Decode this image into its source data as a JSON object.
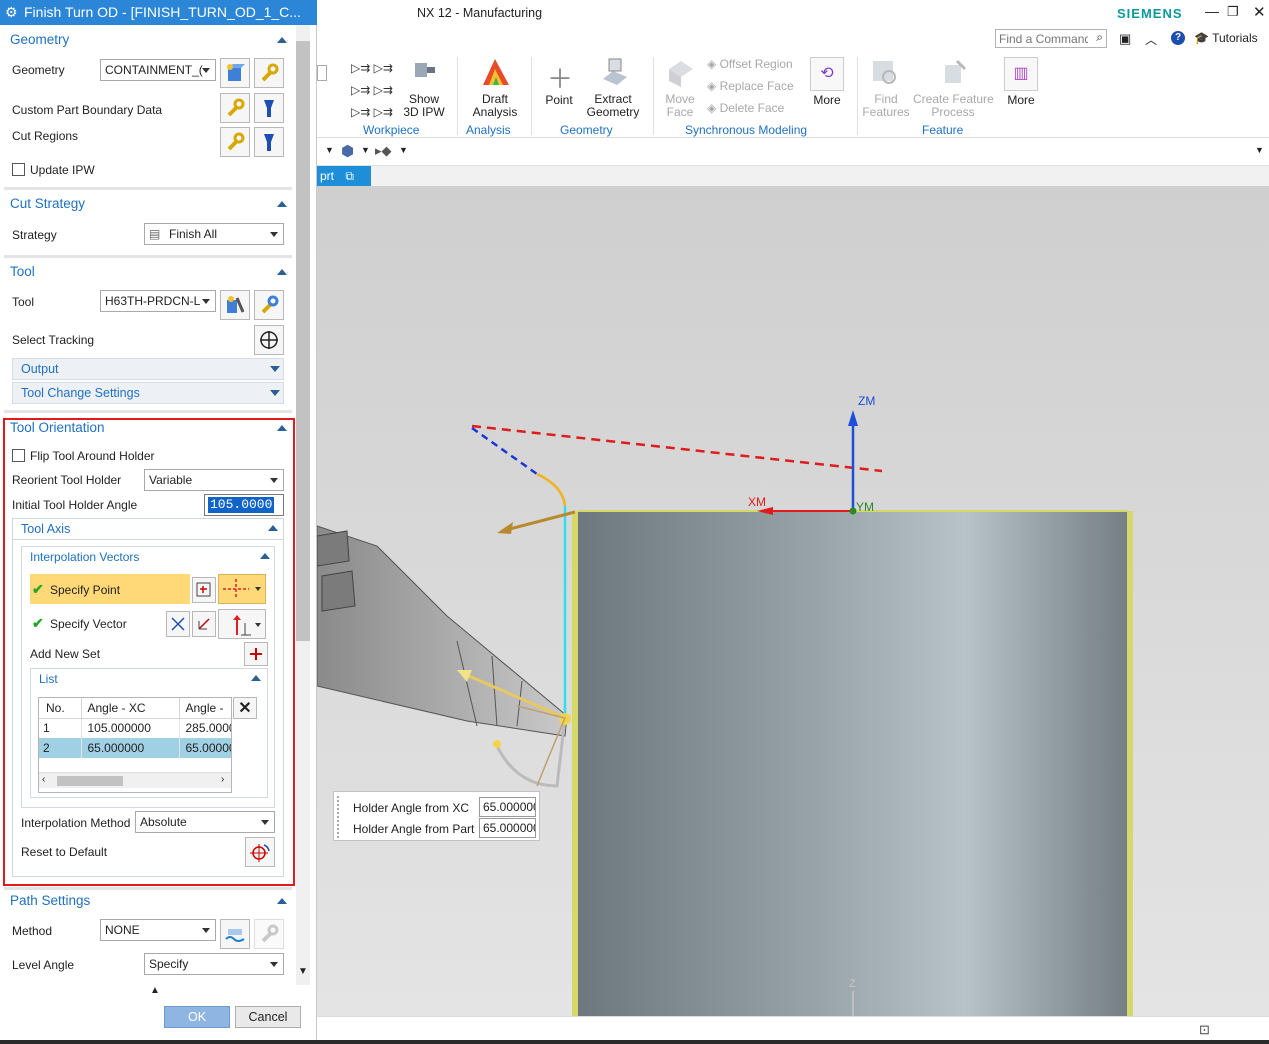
{
  "dialog": {
    "title": "Finish Turn OD - [FINISH_TURN_OD_1_C...",
    "geometry": {
      "header": "Geometry",
      "geometry_label": "Geometry",
      "geometry_value": "CONTAINMENT_(",
      "custom_boundary": "Custom Part Boundary Data",
      "cut_regions": "Cut Regions",
      "update_ipw": "Update IPW"
    },
    "cut_strategy": {
      "header": "Cut Strategy",
      "strategy_label": "Strategy",
      "strategy_value": "Finish All"
    },
    "tool": {
      "header": "Tool",
      "tool_label": "Tool",
      "tool_value": "H63TH-PRDCN-L",
      "select_tracking": "Select Tracking",
      "output": "Output",
      "tool_change": "Tool Change Settings"
    },
    "tool_orientation": {
      "header": "Tool Orientation",
      "flip": "Flip Tool Around Holder",
      "reorient_label": "Reorient Tool Holder",
      "reorient_value": "Variable",
      "initial_angle_label": "Initial Tool Holder Angle",
      "initial_angle_value": "105.0000",
      "tool_axis": "Tool Axis",
      "interp_vectors": "Interpolation Vectors",
      "specify_point": "Specify Point",
      "specify_vector": "Specify Vector",
      "add_new_set": "Add New Set",
      "list": {
        "header": "List",
        "columns": [
          "No.",
          "Angle - XC",
          "Angle -"
        ],
        "rows": [
          [
            "1",
            "105.000000",
            "285.0000"
          ],
          [
            "2",
            "65.000000",
            "65.00000"
          ]
        ]
      },
      "interp_method_label": "Interpolation Method",
      "interp_method_value": "Absolute",
      "reset": "Reset to Default"
    },
    "path_settings": {
      "header": "Path Settings",
      "method_label": "Method",
      "method_value": "NONE",
      "level_angle_label": "Level Angle",
      "level_angle_value": "Specify"
    },
    "ok": "OK",
    "cancel": "Cancel"
  },
  "app": {
    "title": "NX 12 - Manufacturing",
    "brand": "SIEMENS",
    "find_placeholder": "Find a Command",
    "tutorials": "Tutorials"
  },
  "ribbon": {
    "show_ipw": "Show\n3D IPW",
    "draft_analysis": "Draft\nAnalysis",
    "point": "Point",
    "extract_geometry": "Extract\nGeometry",
    "move_face": "Move\nFace",
    "offset_region": "Offset Region",
    "replace_face": "Replace Face",
    "delete_face": "Delete Face",
    "more1": "More",
    "find_features": "Find\nFeatures",
    "create_feature_process": "Create Feature\nProcess",
    "more2": "More",
    "groups": {
      "workpiece": "Workpiece",
      "analysis": "Analysis",
      "geometry": "Geometry",
      "sync": "Synchronous Modeling",
      "feature": "Feature"
    }
  },
  "tab": {
    "label": "prt"
  },
  "viewport": {
    "zm": "ZM",
    "xm": "XM",
    "ym": "YM",
    "z": "Z",
    "holder_xc_label": "Holder Angle from XC",
    "holder_xc_value": "65.000000",
    "holder_part_label": "Holder Angle from Part",
    "holder_part_value": "65.000000"
  }
}
